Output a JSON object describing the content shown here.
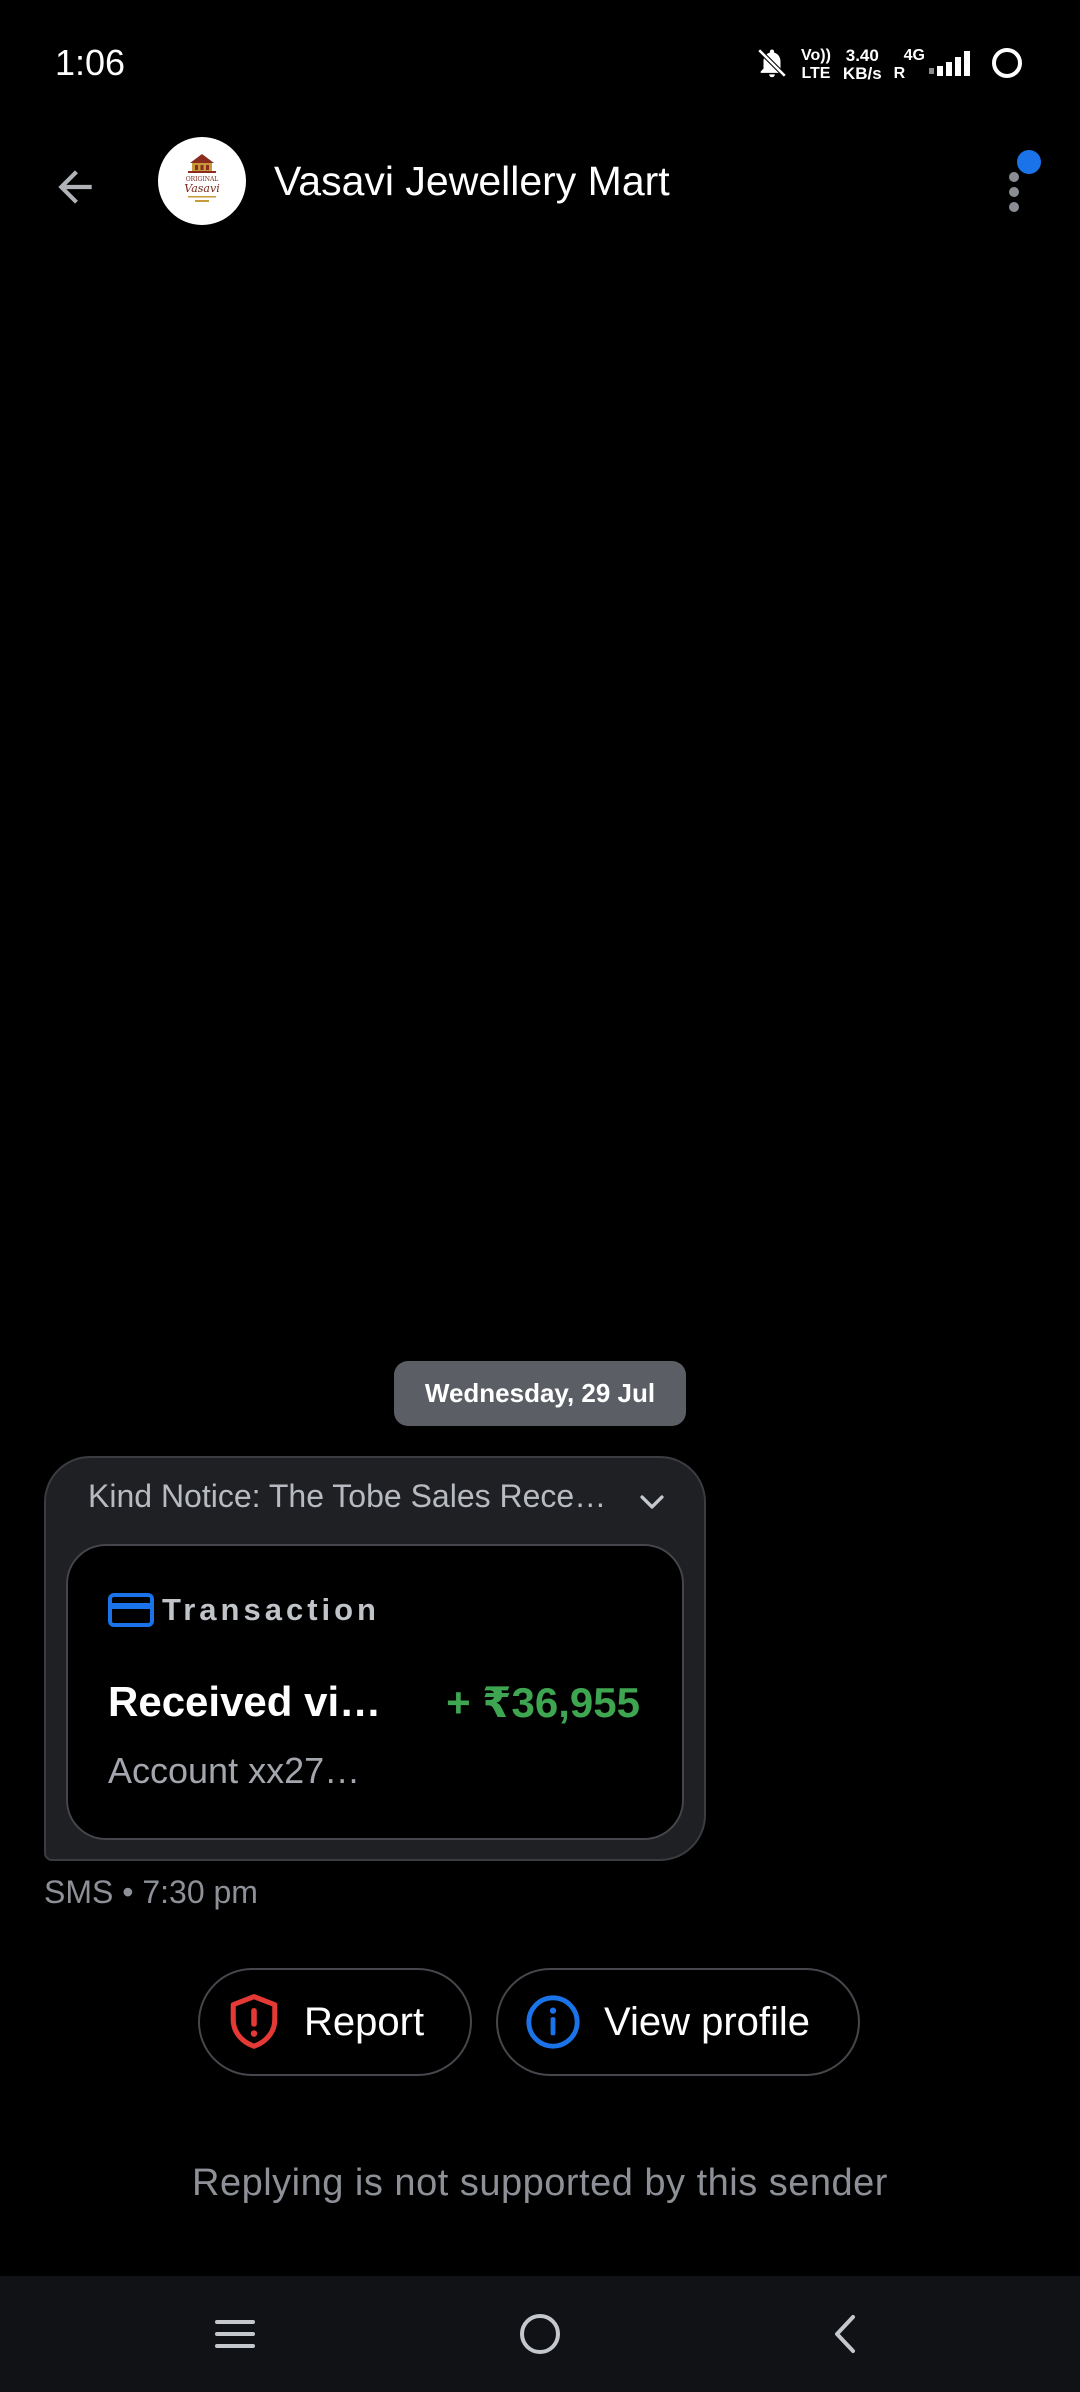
{
  "status_bar": {
    "time": "1:06",
    "volte_top": "Vo))",
    "volte_bottom": "LTE",
    "speed_value": "3.40",
    "speed_unit": "KB/s",
    "network_type": "4G",
    "roaming": "R",
    "icons": [
      "mute-bell-icon",
      "signal-bars-icon",
      "battery-ring-icon"
    ]
  },
  "header": {
    "contact_name": "Vasavi Jewellery Mart",
    "avatar_logo": "Vasavi",
    "icons": [
      "back-arrow-icon",
      "more-vert-icon",
      "notification-dot"
    ]
  },
  "conversation": {
    "date_chip": "Wednesday, 29 Jul",
    "message": {
      "preview": "Kind Notice: The Tobe Sales Rece…",
      "card": {
        "type_label": "Transaction",
        "title": "Received vi…",
        "amount": "+ ₹36,955",
        "subtitle": "Account xx27…"
      },
      "meta": "SMS • 7:30 pm"
    }
  },
  "actions": {
    "report_label": "Report",
    "view_profile_label": "View profile"
  },
  "footer": {
    "reply_note": "Replying is not supported by this sender"
  },
  "colors": {
    "background": "#000000",
    "bubble": "#1f2023",
    "accent_blue": "#1a73e8",
    "report_red": "#e53935",
    "amount_green": "#3ea550"
  }
}
